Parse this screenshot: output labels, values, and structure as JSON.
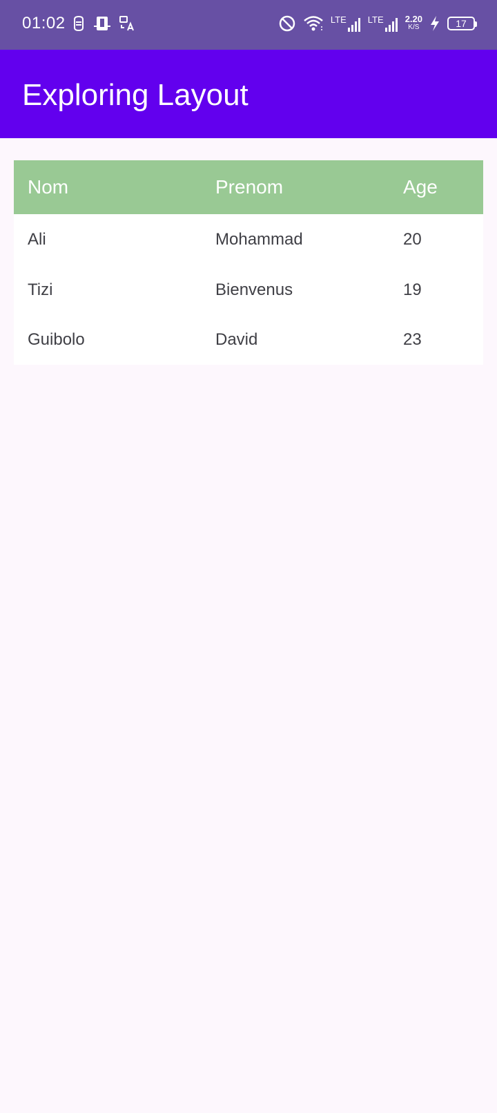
{
  "status_bar": {
    "time": "01:02",
    "left_icons": [
      "notification-icon",
      "device-icon",
      "translate-icon"
    ],
    "right_icons": [
      "do-not-disturb-icon",
      "wifi-icon",
      "signal-1-icon",
      "signal-2-icon",
      "charging-icon"
    ],
    "lte1": "LTE",
    "lte2": "LTE",
    "net_speed": "2.20",
    "net_speed_unit": "K/S",
    "battery": "17"
  },
  "app_bar": {
    "title": "Exploring Layout",
    "color": "#6200ee"
  },
  "table": {
    "header_color": "#99c994",
    "headers": {
      "nom": "Nom",
      "prenom": "Prenom",
      "age": "Age"
    },
    "rows": [
      {
        "nom": "Ali",
        "prenom": "Mohammad",
        "age": "20"
      },
      {
        "nom": "Tizi",
        "prenom": "Bienvenus",
        "age": "19"
      },
      {
        "nom": "Guibolo",
        "prenom": "David",
        "age": "23"
      }
    ]
  }
}
